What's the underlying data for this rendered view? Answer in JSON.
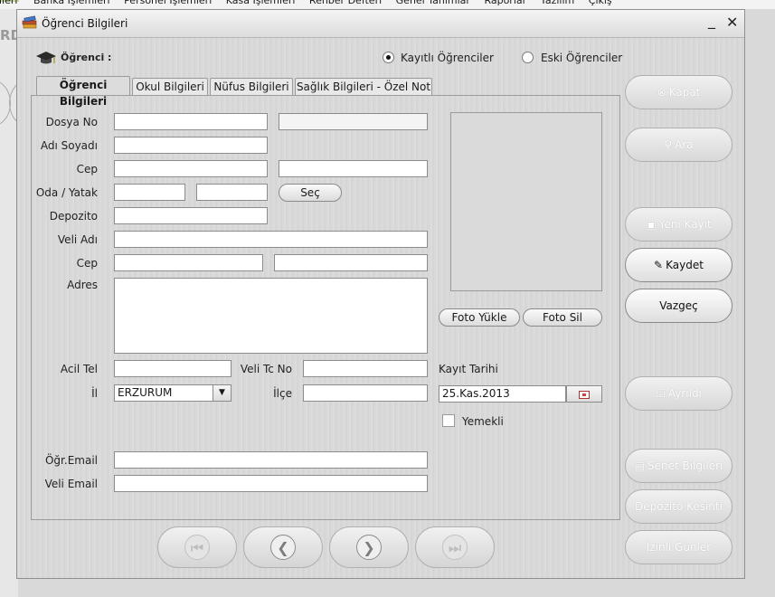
{
  "bg_menu": [
    "Banka İşlemleri",
    "Personel İşlemleri",
    "Kasa İşlemleri",
    "Rehber Defteri",
    "Genel Tanımlar",
    "Raporlar",
    "Yazılım",
    "Çıkış"
  ],
  "bg_menu_first": "lleri",
  "bg_side_text": "RD",
  "window": {
    "title": "Öğrenci Bilgileri",
    "minimize": "_",
    "close": "✕"
  },
  "header": {
    "label": "Öğrenci :",
    "radio_registered": "Kayıtlı Öğrenciler",
    "radio_old": "Eski Öğrenciler"
  },
  "tabs": [
    "Öğrenci Bilgileri",
    "Okul Bilgileri",
    "Nüfus Bilgileri",
    "Sağlık Bilgileri - Özel Not"
  ],
  "form": {
    "dosya_no": "Dosya No",
    "adi_soyadi": "Adı Soyadı",
    "cep": "Cep",
    "oda_yatak": "Oda / Yatak",
    "sec_button": "Seç",
    "depozito": "Depozito",
    "veli_adi": "Veli Adı",
    "veli_cep": "Cep",
    "adres": "Adres",
    "acil_tel": "Acil Tel",
    "veli_tc_no": "Veli Tc No",
    "kayit_tarihi": "Kayıt Tarihi",
    "il": "İl",
    "il_value": "ERZURUM",
    "ilce": "İlçe",
    "kayit_tarihi_value": "25.Kas.2013",
    "yemekli": "Yemekli",
    "ogr_email": "Öğr.Email",
    "veli_email": "Veli Email"
  },
  "photo": {
    "upload": "Foto Yükle",
    "delete": "Foto Sil"
  },
  "side_buttons": {
    "kapat": "Kapat",
    "ara": "Ara",
    "yeni_kayit": "Yeni Kayıt",
    "kaydet": "Kaydet",
    "vazgec": "Vazgeç",
    "ayrildi": "Ayrıldı",
    "senet": "Senet Bilgileri",
    "depozito_kesinti": "Depozito Kesinti",
    "izinli": "İzinli Günler"
  }
}
